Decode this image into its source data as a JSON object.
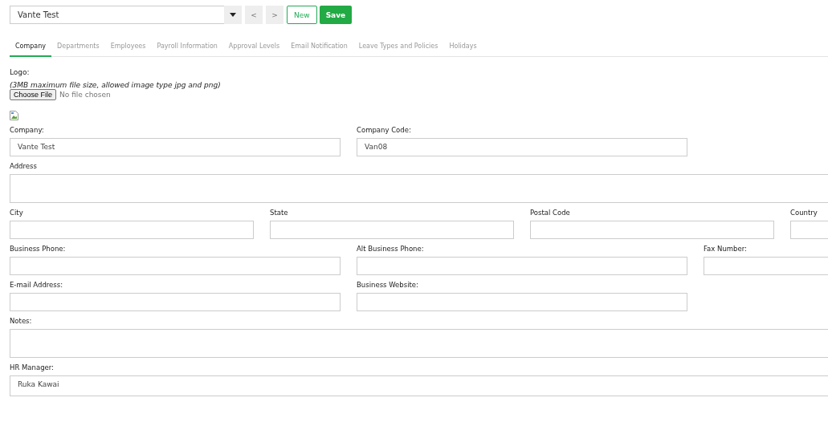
{
  "toolbar": {
    "record": "Vante Test",
    "prev": "<",
    "next": ">",
    "new": "New",
    "save": "Save"
  },
  "tabs": [
    {
      "label": "Company",
      "selected": true
    },
    {
      "label": "Departments",
      "selected": false
    },
    {
      "label": "Employees",
      "selected": false
    },
    {
      "label": "Payroll Information",
      "selected": false
    },
    {
      "label": "Approval Levels",
      "selected": false
    },
    {
      "label": "Email Notification",
      "selected": false
    },
    {
      "label": "Leave Types and Policies",
      "selected": false
    },
    {
      "label": "Holidays",
      "selected": false
    }
  ],
  "logo": {
    "label": "Logo:",
    "hint": "(3MB maximum file size, allowed image type jpg and png)",
    "button": "Choose File",
    "status": "No file chosen"
  },
  "rows": [
    {
      "fields": [
        {
          "label": "Company:",
          "value": "Vante Test",
          "kind": "text"
        },
        {
          "label": "Company Code:",
          "value": "Van08",
          "kind": "text"
        }
      ]
    },
    {
      "fields": [
        {
          "label": "Address",
          "kind": "area"
        }
      ]
    },
    {
      "fields": [
        {
          "label": "City",
          "kind": "text"
        },
        {
          "label": "State",
          "kind": "text"
        },
        {
          "label": "Postal Code",
          "kind": "text"
        },
        {
          "label": "Country",
          "kind": "text"
        }
      ]
    },
    {
      "fields": [
        {
          "label": "Business Phone:",
          "kind": "text"
        },
        {
          "label": "Alt Business Phone:",
          "kind": "text"
        },
        {
          "label": "Fax Number:",
          "kind": "text"
        }
      ]
    },
    {
      "fields": [
        {
          "label": "E-mail Address:",
          "kind": "text"
        },
        {
          "label": "Business Website:",
          "kind": "text"
        }
      ]
    },
    {
      "fields": [
        {
          "label": "Notes:",
          "kind": "area"
        }
      ]
    },
    {
      "fields": [
        {
          "label": "HR Manager:",
          "value": "Ruka Kawai",
          "kind": "wide"
        }
      ]
    }
  ]
}
